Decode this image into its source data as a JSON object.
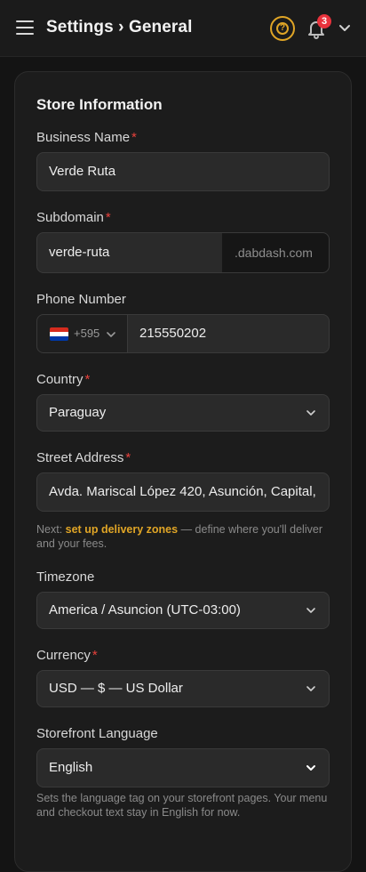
{
  "header": {
    "breadcrumb_parent": "Settings",
    "breadcrumb_sep": "›",
    "breadcrumb_current": "General",
    "help_glyph": "?",
    "notification_count": "3",
    "icons": [
      "menu-icon",
      "help-icon",
      "bell-icon",
      "chevron-down-icon"
    ]
  },
  "section": {
    "title": "Store Information"
  },
  "form": {
    "business_name": {
      "label": "Business Name",
      "required": "*",
      "value": "Verde Ruta"
    },
    "subdomain": {
      "label": "Subdomain",
      "required": "*",
      "value": "verde-ruta",
      "suffix": ".dabdash.com"
    },
    "phone": {
      "label": "Phone Number",
      "dial_code": "+595",
      "value": "215550202"
    },
    "country": {
      "label": "Country",
      "required": "*",
      "value": "Paraguay"
    },
    "street_address": {
      "label": "Street Address",
      "required": "*",
      "value": "Avda. Mariscal López 420, Asunción, Capital,",
      "hint_prefix": "Next: ",
      "hint_link": "set up delivery zones",
      "hint_suffix": " — define where you'll deliver and your fees."
    },
    "timezone": {
      "label": "Timezone",
      "value": "America / Asuncion (UTC-03:00)"
    },
    "currency": {
      "label": "Currency",
      "required": "*",
      "value": "USD — $ — US Dollar"
    },
    "storefront_language": {
      "label": "Storefront Language",
      "value": "English",
      "hint": "Sets the language tag on your storefront pages. Your menu and checkout text stay in English for now."
    }
  },
  "colors": {
    "background": "#141414",
    "card": "#1c1c1c",
    "accent": "#e0a526",
    "required": "#e8413c",
    "badge": "#e8323c"
  }
}
